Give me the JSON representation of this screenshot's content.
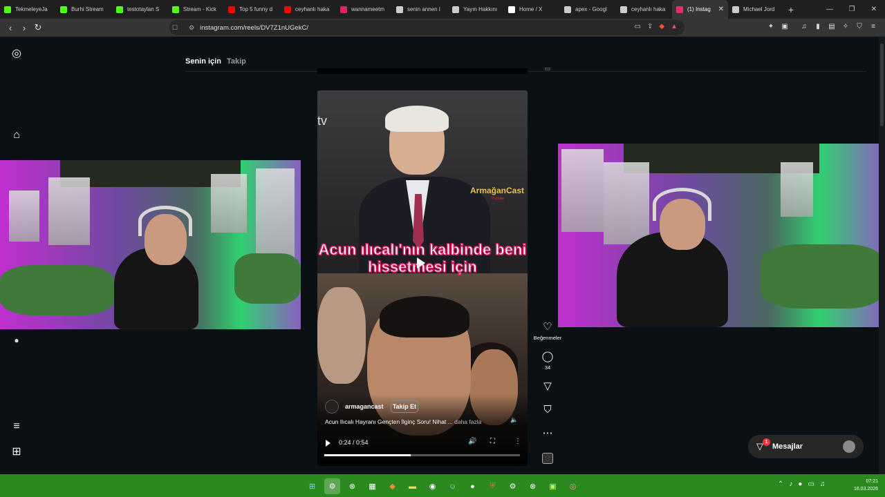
{
  "browser": {
    "tabs": [
      {
        "title": "TekmeleyeJa",
        "icon": "kick-icon",
        "color": "#53fc18",
        "active": false
      },
      {
        "title": "Burhi Stream",
        "icon": "kick-icon",
        "color": "#53fc18",
        "active": false
      },
      {
        "title": "testotaylan S",
        "icon": "kick-icon",
        "color": "#53fc18",
        "active": false
      },
      {
        "title": "Stream - Kick",
        "icon": "kick-icon",
        "color": "#53fc18",
        "active": false
      },
      {
        "title": "Top 5 funny d",
        "icon": "youtube-icon",
        "color": "#ff0000",
        "active": false
      },
      {
        "title": "ceyhanlı haka",
        "icon": "youtube-icon",
        "color": "#ff0000",
        "active": false
      },
      {
        "title": "wannameetm",
        "icon": "wanna-icon",
        "color": "#e0245e",
        "active": false
      },
      {
        "title": "senin annen l",
        "icon": "google-icon",
        "color": "#cccccc",
        "active": false
      },
      {
        "title": "Yayın Hakkını",
        "icon": "page-icon",
        "color": "#cccccc",
        "active": false
      },
      {
        "title": "Home / X",
        "icon": "x-icon",
        "color": "#ffffff",
        "active": false
      },
      {
        "title": "apex - Googl",
        "icon": "google-icon",
        "color": "#cccccc",
        "active": false
      },
      {
        "title": "ceyhanlı haka",
        "icon": "google-icon",
        "color": "#cccccc",
        "active": false
      },
      {
        "title": "(1) Instag",
        "icon": "instagram-icon",
        "color": "#e1306c",
        "active": true
      },
      {
        "title": "Michael Jord",
        "icon": "google-icon",
        "color": "#cccccc",
        "active": false
      }
    ],
    "new_tab": "+",
    "url": "instagram.com/reels/DV7Z1nUGekC/"
  },
  "instagram": {
    "feed_tabs": {
      "for_you": "Senin için",
      "following": "Takip"
    },
    "reel": {
      "caption": "Acun ılıcalı'nın kalbinde beni hissetmesi için",
      "brand": "ArmağanCast",
      "brand_sub": "Youtube",
      "tv_logo": "tv",
      "username": "armagancast",
      "follow_label": "Takip Et",
      "description": "Acun Ilıcalı Hayranı Gençten İlginç Soru! Nihat ...",
      "more_label": "daha fazla",
      "time_display": "0:24 / 0:54",
      "progress": 0.44
    },
    "actions": {
      "likes_label": "Beğenmeler",
      "comments_count": "34"
    },
    "messages": {
      "label": "Mesajlar",
      "badge": "1"
    }
  },
  "taskbar": {
    "time": "07:21",
    "date": "16.03.2026"
  }
}
